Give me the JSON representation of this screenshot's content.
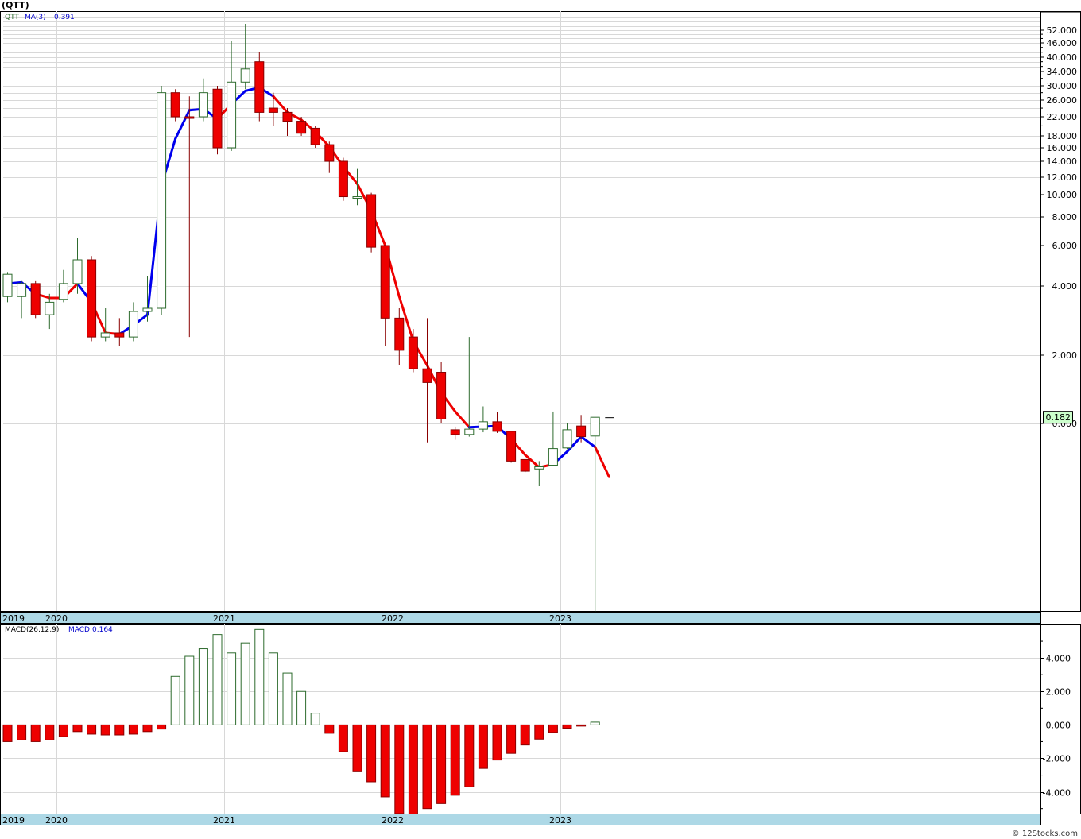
{
  "title": "(QTT)",
  "footer": "© 12Stocks.com",
  "colors": {
    "up": "#ffffff",
    "up_stroke": "#2e6b2e",
    "down": "#ee0000",
    "down_stroke": "#8b0000",
    "ma_up": "#0000ee",
    "ma_down": "#ee0000",
    "axis_bar": "#add8e6",
    "grid": "#d8d8d8",
    "last_label_bg": "#ccffcc"
  },
  "chart_data": [
    {
      "type": "candlestick",
      "scale": "log-offset",
      "legend": {
        "symbol": "QTT",
        "ma_label": "MA(3)",
        "ma_value": "0.391"
      },
      "last_price_label": "0.182",
      "x_labels": [
        {
          "label": "2019",
          "index": -0.8
        },
        {
          "label": "2020",
          "index": 4
        },
        {
          "label": "2021",
          "index": 16
        },
        {
          "label": "2022",
          "index": 28
        },
        {
          "label": "2023",
          "index": 40
        }
      ],
      "y_ticks": [
        52,
        46,
        40,
        34,
        30,
        26,
        22,
        18,
        16,
        14,
        12,
        10,
        8,
        6,
        4,
        2,
        0
      ],
      "y_tick_labels": [
        "52.000",
        "46.000",
        "40.000",
        "34.000",
        "30.000",
        "26.000",
        "22.000",
        "18.000",
        "16.000",
        "14.000",
        "12.000",
        "10.000",
        "8.000",
        "6.000",
        "4.000",
        "2.000",
        "0.000"
      ],
      "grid_values": [
        50,
        48,
        44,
        42,
        38,
        36,
        32,
        28,
        24,
        20
      ],
      "candles": [
        {
          "o": 3.6,
          "h": 4.6,
          "l": 3.4,
          "c": 4.5
        },
        {
          "o": 3.6,
          "h": 4.2,
          "l": 2.9,
          "c": 4.1
        },
        {
          "o": 4.1,
          "h": 4.2,
          "l": 2.9,
          "c": 3.0
        },
        {
          "o": 3.0,
          "h": 3.7,
          "l": 2.6,
          "c": 3.4
        },
        {
          "o": 3.5,
          "h": 4.7,
          "l": 3.4,
          "c": 4.1
        },
        {
          "o": 4.1,
          "h": 6.5,
          "l": 3.7,
          "c": 5.2
        },
        {
          "o": 5.2,
          "h": 5.4,
          "l": 2.3,
          "c": 2.4
        },
        {
          "o": 2.4,
          "h": 3.2,
          "l": 2.3,
          "c": 2.5
        },
        {
          "o": 2.5,
          "h": 2.9,
          "l": 2.2,
          "c": 2.4
        },
        {
          "o": 2.4,
          "h": 3.4,
          "l": 2.3,
          "c": 3.1
        },
        {
          "o": 3.1,
          "h": 4.4,
          "l": 2.8,
          "c": 3.2
        },
        {
          "o": 3.2,
          "h": 30,
          "l": 3.0,
          "c": 28
        },
        {
          "o": 28,
          "h": 29,
          "l": 21,
          "c": 22
        },
        {
          "o": 22,
          "h": 27,
          "l": 2.4,
          "c": 21.8
        },
        {
          "o": 22,
          "h": 32,
          "l": 21,
          "c": 28
        },
        {
          "o": 29,
          "h": 30,
          "l": 15,
          "c": 16
        },
        {
          "o": 16,
          "h": 47,
          "l": 15.5,
          "c": 31
        },
        {
          "o": 31,
          "h": 55,
          "l": 29,
          "c": 35
        },
        {
          "o": 38,
          "h": 42,
          "l": 21,
          "c": 23
        },
        {
          "o": 24,
          "h": 28,
          "l": 20,
          "c": 23
        },
        {
          "o": 23,
          "h": 24,
          "l": 18,
          "c": 21
        },
        {
          "o": 21,
          "h": 22,
          "l": 18,
          "c": 18.5
        },
        {
          "o": 19.5,
          "h": 20,
          "l": 16,
          "c": 16.5
        },
        {
          "o": 16.5,
          "h": 17,
          "l": 12.5,
          "c": 14
        },
        {
          "o": 14,
          "h": 14.5,
          "l": 9.4,
          "c": 9.8
        },
        {
          "o": 9.8,
          "h": 13,
          "l": 9,
          "c": 9.8
        },
        {
          "o": 10,
          "h": 10.2,
          "l": 5.6,
          "c": 5.9
        },
        {
          "o": 6.0,
          "h": 6.0,
          "l": 2.2,
          "c": 2.9
        },
        {
          "o": 2.9,
          "h": 3.2,
          "l": 1.7,
          "c": 2.1
        },
        {
          "o": 2.4,
          "h": 2.6,
          "l": 1.5,
          "c": 1.6
        },
        {
          "o": 1.6,
          "h": 2.9,
          "l": -0.6,
          "c": 1.2
        },
        {
          "o": 1.5,
          "h": 1.8,
          "l": 0,
          "c": 0.13
        },
        {
          "o": -0.2,
          "h": -0.1,
          "l": -0.52,
          "c": -0.35
        },
        {
          "o": -0.35,
          "h": 2.4,
          "l": -0.42,
          "c": -0.18
        },
        {
          "o": -0.18,
          "h": 0.5,
          "l": -0.28,
          "c": 0.05
        },
        {
          "o": 0.05,
          "h": 0.33,
          "l": -0.3,
          "c": -0.25
        },
        {
          "o": -0.25,
          "h": -0.28,
          "l": -1.25,
          "c": -1.2
        },
        {
          "o": -1.15,
          "h": -1.17,
          "l": -1.55,
          "c": -1.52
        },
        {
          "o": -1.45,
          "h": -1.2,
          "l": -2.0,
          "c": -1.38
        },
        {
          "o": -1.33,
          "h": 0.35,
          "l": -1.35,
          "c": -0.8
        },
        {
          "o": -0.78,
          "h": 0.0,
          "l": -0.82,
          "c": -0.2
        },
        {
          "o": -0.08,
          "h": 0.25,
          "l": -0.6,
          "c": -0.42
        },
        {
          "o": -0.4,
          "h": -0.36,
          "l": -6.0,
          "c": 0.182
        },
        {
          "o": 0.182,
          "h": 0.182,
          "l": 0.182,
          "c": 0.182
        }
      ],
      "ma": [
        4.1,
        4.15,
        3.7,
        3.55,
        3.55,
        4.1,
        3.4,
        2.5,
        2.47,
        2.7,
        3.0,
        11.0,
        17.5,
        23.5,
        23.8,
        21.5,
        25,
        28.5,
        29.5,
        27.0,
        23.0,
        21.3,
        18.8,
        16.2,
        13.3,
        11.2,
        8.5,
        6.0,
        3.6,
        2.3,
        1.7,
        0.9,
        0.35,
        -0.12,
        -0.1,
        -0.08,
        -0.5,
        -1.0,
        -1.4,
        -1.3,
        -0.9,
        -0.42,
        -0.75,
        -1.7
      ],
      "ma_colors": [
        "up",
        "up",
        "down",
        "down",
        "down",
        "up",
        "down",
        "down",
        "up",
        "up",
        "up",
        "up",
        "up",
        "up",
        "up",
        "down",
        "up",
        "up",
        "up",
        "down",
        "down",
        "down",
        "down",
        "down",
        "down",
        "down",
        "down",
        "down",
        "down",
        "down",
        "down",
        "down",
        "down",
        "up",
        "up",
        "up",
        "down",
        "down",
        "down",
        "up",
        "up",
        "up",
        "down",
        "down"
      ]
    },
    {
      "type": "bar",
      "legend": {
        "label": "MACD(26,12,9)",
        "value_label": "MACD:0.164"
      },
      "y_ticks": [
        4,
        2,
        0,
        -2,
        -4
      ],
      "y_tick_labels": [
        "4.000",
        "2.000",
        "0.000",
        "-2.000",
        "-4.000"
      ],
      "ylim": [
        -5.3,
        6.0
      ],
      "values": [
        -1.0,
        -0.9,
        -1.0,
        -0.9,
        -0.7,
        -0.4,
        -0.55,
        -0.6,
        -0.6,
        -0.55,
        -0.4,
        -0.25,
        2.9,
        4.1,
        4.55,
        5.4,
        4.3,
        4.9,
        5.7,
        4.3,
        3.1,
        2.0,
        0.7,
        -0.5,
        -1.6,
        -2.8,
        -3.4,
        -4.3,
        -5.3,
        -5.4,
        -5.0,
        -4.7,
        -4.2,
        -3.7,
        -2.6,
        -2.1,
        -1.7,
        -1.2,
        -0.85,
        -0.45,
        -0.2,
        -0.05,
        0.164
      ],
      "x_labels": [
        {
          "label": "2019",
          "index": -0.8
        },
        {
          "label": "2020",
          "index": 4
        },
        {
          "label": "2021",
          "index": 16
        },
        {
          "label": "2022",
          "index": 28
        },
        {
          "label": "2023",
          "index": 40
        }
      ]
    }
  ]
}
